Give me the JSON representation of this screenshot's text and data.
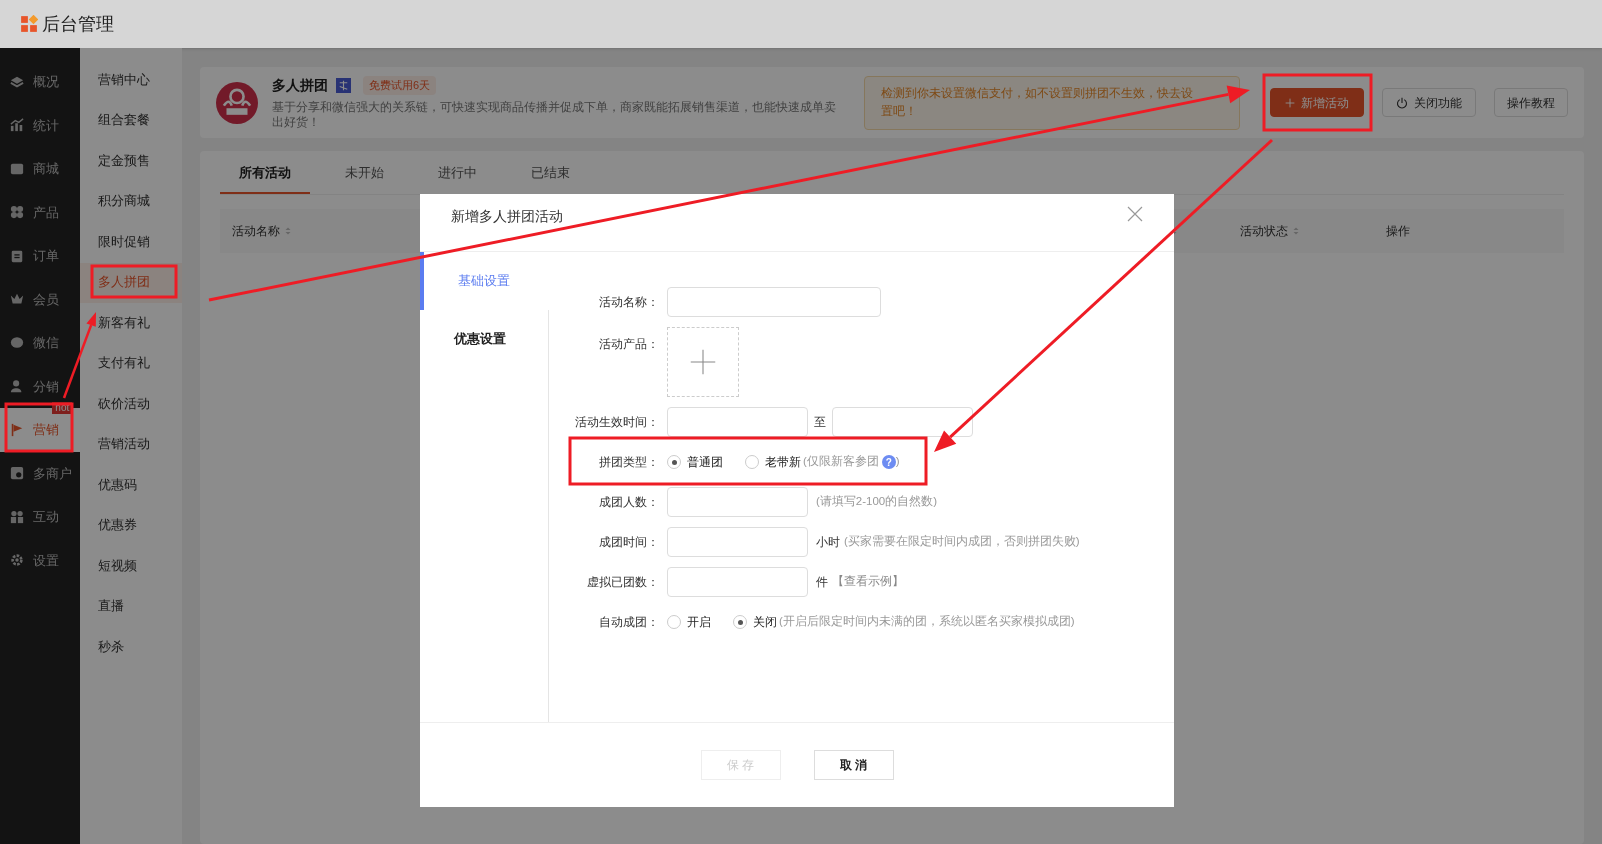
{
  "app": {
    "title": "后台管理"
  },
  "sidebar": {
    "items": [
      {
        "label": "概况",
        "selected": false
      },
      {
        "label": "统计",
        "selected": false
      },
      {
        "label": "商城",
        "selected": false
      },
      {
        "label": "产品",
        "selected": false
      },
      {
        "label": "订单",
        "selected": false
      },
      {
        "label": "会员",
        "selected": false
      },
      {
        "label": "微信",
        "selected": false
      },
      {
        "label": "分销",
        "selected": false
      },
      {
        "label": "营销",
        "selected": true,
        "badge": "hot"
      },
      {
        "label": "多商户",
        "selected": false
      },
      {
        "label": "互动",
        "selected": false
      },
      {
        "label": "设置",
        "selected": false
      }
    ]
  },
  "submenu": {
    "items": [
      {
        "label": "营销中心",
        "selected": false
      },
      {
        "label": "组合套餐",
        "selected": false
      },
      {
        "label": "定金预售",
        "selected": false
      },
      {
        "label": "积分商城",
        "selected": false
      },
      {
        "label": "限时促销",
        "selected": false
      },
      {
        "label": "多人拼团",
        "selected": true
      },
      {
        "label": "新客有礼",
        "selected": false
      },
      {
        "label": "支付有礼",
        "selected": false
      },
      {
        "label": "砍价活动",
        "selected": false
      },
      {
        "label": "营销活动",
        "selected": false
      },
      {
        "label": "优惠码",
        "selected": false
      },
      {
        "label": "优惠券",
        "selected": false
      },
      {
        "label": "短视频",
        "selected": false
      },
      {
        "label": "直播",
        "selected": false
      },
      {
        "label": "秒杀",
        "selected": false
      }
    ]
  },
  "plugin": {
    "name": "多人拼团",
    "trial_badge": "免费试用6天",
    "description": "基于分享和微信强大的关系链，可快速实现商品传播并促成下单，商家既能拓展销售渠道，也能快速成单卖出好货！",
    "alert": "检测到你未设置微信支付，如不设置则拼团不生效，快去设置吧！",
    "buttons": [
      {
        "label": "新增活动",
        "kind": "primary"
      },
      {
        "label": "关闭功能",
        "kind": "power"
      },
      {
        "label": "操作教程",
        "kind": "plain"
      }
    ]
  },
  "tabs": [
    {
      "label": "所有活动",
      "selected": true
    },
    {
      "label": "未开始",
      "selected": false
    },
    {
      "label": "进行中",
      "selected": false
    },
    {
      "label": "已结束",
      "selected": false
    }
  ],
  "table": {
    "columns": [
      {
        "label": "活动名称",
        "sortable": true
      },
      {
        "sortable": true
      },
      {
        "label": "活动状态",
        "sortable": true
      },
      {
        "label": "操作",
        "sortable": false
      }
    ]
  },
  "modal": {
    "title": "新增多人拼团活动",
    "nav": [
      {
        "label": "基础设置",
        "selected": true
      },
      {
        "label": "优惠设置",
        "selected": false
      }
    ],
    "fields": [
      {
        "kind": "text",
        "label": "活动名称：",
        "wide": true
      },
      {
        "kind": "upload",
        "label": "活动产品："
      },
      {
        "kind": "range",
        "label": "活动生效时间：",
        "separator": "至"
      },
      {
        "kind": "radio",
        "label": "拼团类型：",
        "options": [
          {
            "label": "普通团",
            "selected": true
          },
          {
            "label": "老带新",
            "selected": false,
            "hint": "(仅限新客参团",
            "help": "?",
            "hint_end": ")"
          }
        ]
      },
      {
        "kind": "text",
        "label": "成团人数：",
        "suffix": "(请填写2-100的自然数)"
      },
      {
        "kind": "text",
        "label": "成团时间：",
        "unit": "小时",
        "suffix": "(买家需要在限定时间内成团，否则拼团失败)"
      },
      {
        "kind": "text",
        "label": "虚拟已团数：",
        "unit": "件",
        "link": "【查看示例】"
      },
      {
        "kind": "radio",
        "label": "自动成团：",
        "options": [
          {
            "label": "开启",
            "selected": false
          },
          {
            "label": "关闭",
            "selected": true,
            "hint": "(开启后限定时间内未满的团，系统以匿名买家模拟成团)"
          }
        ]
      }
    ],
    "buttons": [
      {
        "label": "保 存",
        "disabled": true
      },
      {
        "label": "取 消",
        "disabled": false
      }
    ]
  }
}
